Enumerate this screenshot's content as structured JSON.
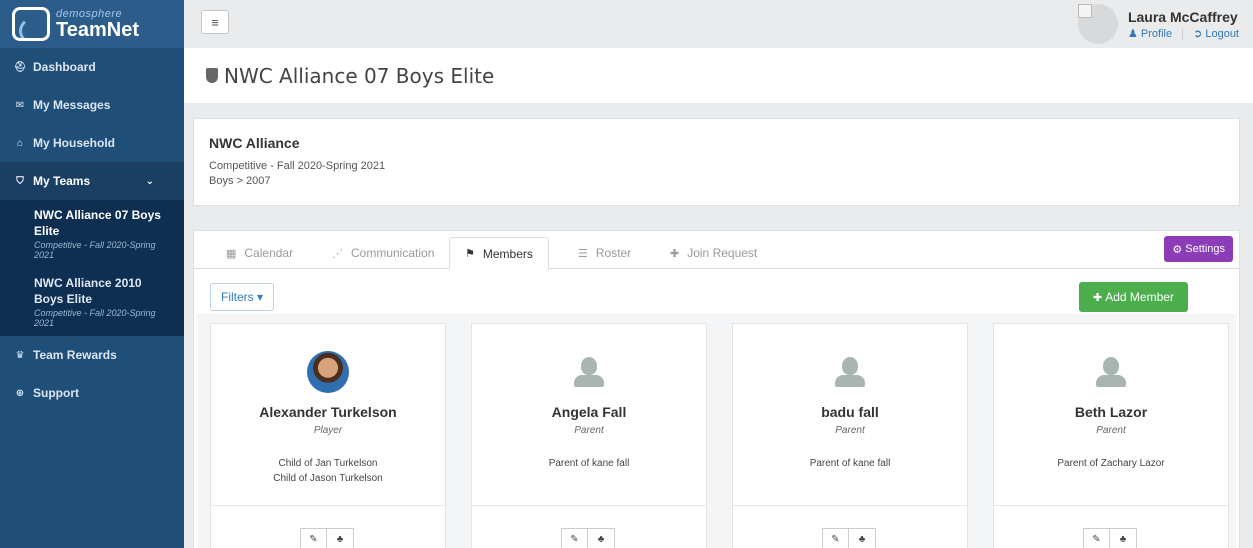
{
  "logo": {
    "small": "demosphere",
    "big": "TeamNet"
  },
  "sidebar": {
    "items": [
      {
        "icon": "⛑",
        "label": "Dashboard"
      },
      {
        "icon": "✉",
        "label": "My Messages"
      },
      {
        "icon": "⌂",
        "label": "My Household"
      },
      {
        "icon": "⛉",
        "label": "My Teams"
      },
      {
        "icon": "♛",
        "label": "Team Rewards"
      },
      {
        "icon": "⊕",
        "label": "Support"
      }
    ],
    "teams": [
      {
        "title": "NWC Alliance 07 Boys Elite",
        "season": "Competitive - Fall 2020-Spring 2021"
      },
      {
        "title": "NWC Alliance 2010 Boys Elite",
        "season": "Competitive - Fall 2020-Spring 2021"
      }
    ]
  },
  "topbar": {
    "menu_icon": "≡",
    "user_name": "Laura McCaffrey",
    "profile": "Profile",
    "logout": "Logout"
  },
  "page": {
    "title": "NWC Alliance 07 Boys Elite"
  },
  "info": {
    "org": "NWC Alliance",
    "line1": "Competitive - Fall 2020-Spring 2021",
    "line2": "Boys > 2007"
  },
  "tabs": [
    {
      "icon": "▦",
      "label": "Calendar"
    },
    {
      "icon": "⋰",
      "label": "Communication"
    },
    {
      "icon": "⚑",
      "label": "Members"
    },
    {
      "icon": "☰",
      "label": "Roster"
    },
    {
      "icon": "✚",
      "label": "Join Request"
    }
  ],
  "settings_label": "Settings",
  "filters_label": "Filters ▾",
  "add_member_label": "Add Member",
  "members": [
    {
      "name": "Alexander Turkelson",
      "role": "Player",
      "rel1": "Child of Jan Turkelson",
      "rel2": "Child of Jason Turkelson"
    },
    {
      "name": "Angela Fall",
      "role": "Parent",
      "rel1": "Parent of kane fall",
      "rel2": ""
    },
    {
      "name": "badu fall",
      "role": "Parent",
      "rel1": "Parent of kane fall",
      "rel2": ""
    },
    {
      "name": "Beth Lazor",
      "role": "Parent",
      "rel1": "Parent of Zachary Lazor",
      "rel2": ""
    }
  ],
  "action_icons": {
    "edit": "✎",
    "tree": "♣"
  },
  "colors": {
    "sidebar": "#1f4e79",
    "settings": "#8a3db6",
    "add": "#4cae4c",
    "link": "#337ab7"
  }
}
